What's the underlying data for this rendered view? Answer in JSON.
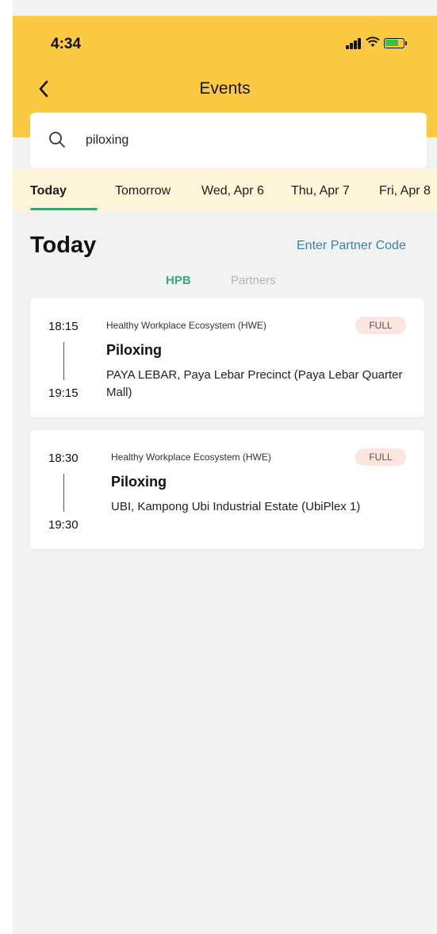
{
  "status_bar": {
    "time": "4:34",
    "wifi_icon": "wifi-icon",
    "battery_icon": "battery-charging-icon",
    "signal_icon": "signal-icon"
  },
  "header": {
    "title": "Events",
    "back_icon": "chevron-left-icon",
    "background": "#fbc942"
  },
  "search": {
    "value": "piloxing",
    "icon": "search-icon"
  },
  "date_tabs": [
    {
      "label": "Today",
      "active": true
    },
    {
      "label": "Tomorrow",
      "active": false
    },
    {
      "label": "Wed, Apr 6",
      "active": false
    },
    {
      "label": "Thu, Apr 7",
      "active": false
    },
    {
      "label": "Fri, Apr 8",
      "active": false
    }
  ],
  "section": {
    "title": "Today",
    "partner_code_link": "Enter Partner Code"
  },
  "segment": {
    "hpb": "HPB",
    "partners": "Partners",
    "selected": "HPB"
  },
  "events": [
    {
      "start": "18:15",
      "end": "19:15",
      "organizer": "Healthy Workplace Ecosystem (HWE)",
      "status": "FULL",
      "name": "Piloxing",
      "location": "PAYA LEBAR, Paya Lebar Precinct (Paya Lebar Quarter Mall)"
    },
    {
      "start": "18:30",
      "end": "19:30",
      "organizer": "Healthy Workplace Ecosystem (HWE)",
      "status": "FULL",
      "name": "Piloxing",
      "location": "UBI, Kampong Ubi Industrial Estate (UbiPlex 1)"
    }
  ],
  "colors": {
    "accent_green": "#3aa37d",
    "link_blue": "#2e86b6",
    "badge_bg": "#fde6e1"
  }
}
